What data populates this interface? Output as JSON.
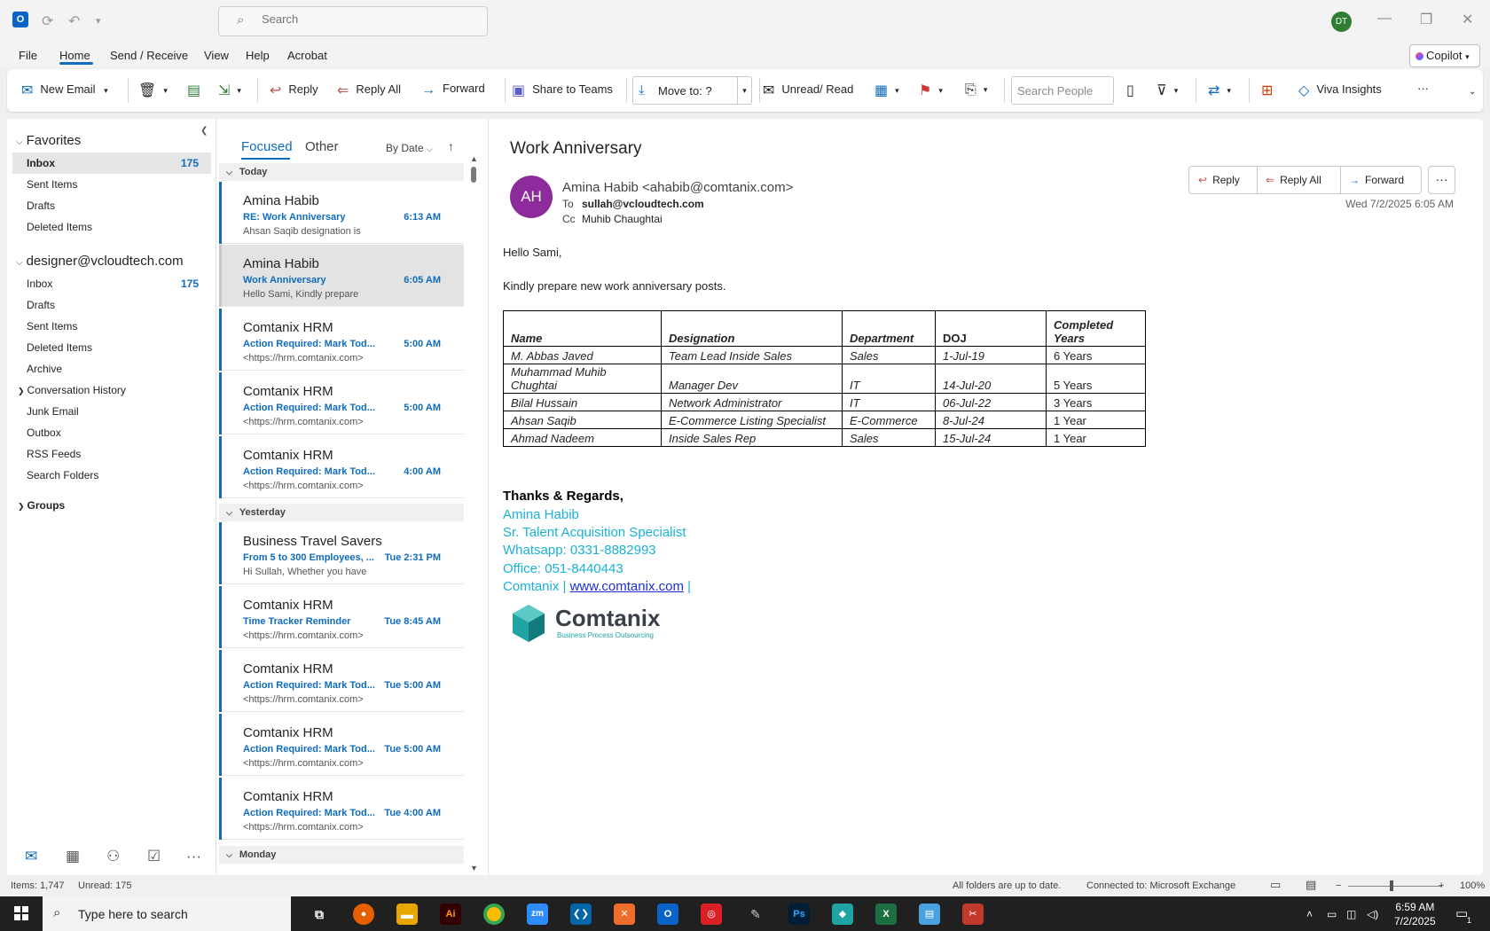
{
  "titlebar": {
    "search_placeholder": "Search",
    "user_initials": "DT"
  },
  "menu": {
    "file": "File",
    "home": "Home",
    "send_receive": "Send / Receive",
    "view": "View",
    "help": "Help",
    "acrobat": "Acrobat",
    "copilot": "Copilot"
  },
  "ribbon": {
    "new_email": "New Email",
    "reply": "Reply",
    "reply_all": "Reply All",
    "forward": "Forward",
    "share_teams": "Share to Teams",
    "move_to": "Move to: ?",
    "unread_read": "Unread/ Read",
    "search_people_placeholder": "Search People",
    "viva": "Viva Insights"
  },
  "folders": {
    "favorites_label": "Favorites",
    "favorites": [
      {
        "label": "Inbox",
        "count": "175",
        "selected": true
      },
      {
        "label": "Sent Items",
        "count": ""
      },
      {
        "label": "Drafts",
        "count": ""
      },
      {
        "label": "Deleted Items",
        "count": ""
      }
    ],
    "account_label": "designer@vcloudtech.com",
    "account": [
      {
        "label": "Inbox",
        "count": "175"
      },
      {
        "label": "Drafts"
      },
      {
        "label": "Sent Items"
      },
      {
        "label": "Deleted Items"
      },
      {
        "label": "Archive"
      },
      {
        "label": "Conversation History"
      },
      {
        "label": "Junk Email"
      },
      {
        "label": "Outbox"
      },
      {
        "label": "RSS Feeds"
      },
      {
        "label": "Search Folders"
      }
    ],
    "groups_label": "Groups"
  },
  "msglist": {
    "tab_focused": "Focused",
    "tab_other": "Other",
    "sort": "By Date",
    "group_today": "Today",
    "group_yesterday": "Yesterday",
    "group_monday": "Monday",
    "messages": [
      {
        "sender": "Amina Habib",
        "subject": "RE: Work Anniversary",
        "time": "6:13 AM",
        "preview": "Ahsan Saqib designation is"
      },
      {
        "sender": "Amina Habib",
        "subject": "Work Anniversary",
        "time": "6:05 AM",
        "preview": "Hello Sami,  Kindly prepare"
      },
      {
        "sender": "Comtanix HRM",
        "subject": "Action Required: Mark Tod...",
        "time": "5:00 AM",
        "preview": "<https://hrm.comtanix.com>"
      },
      {
        "sender": "Comtanix HRM",
        "subject": "Action Required: Mark Tod...",
        "time": "5:00 AM",
        "preview": "<https://hrm.comtanix.com>"
      },
      {
        "sender": "Comtanix HRM",
        "subject": "Action Required: Mark Tod...",
        "time": "4:00 AM",
        "preview": "<https://hrm.comtanix.com>"
      },
      {
        "sender": "Business Travel Savers",
        "subject": "From 5 to 300 Employees, ...",
        "time": "Tue 2:31 PM",
        "preview": "Hi Sullah,  Whether you have"
      },
      {
        "sender": "Comtanix HRM",
        "subject": "Time Tracker Reminder",
        "time": "Tue 8:45 AM",
        "preview": "<https://hrm.comtanix.com>"
      },
      {
        "sender": "Comtanix HRM",
        "subject": "Action Required: Mark Tod...",
        "time": "Tue 5:00 AM",
        "preview": "<https://hrm.comtanix.com>"
      },
      {
        "sender": "Comtanix HRM",
        "subject": "Action Required: Mark Tod...",
        "time": "Tue 5:00 AM",
        "preview": "<https://hrm.comtanix.com>"
      },
      {
        "sender": "Comtanix HRM",
        "subject": "Action Required: Mark Tod...",
        "time": "Tue 4:00 AM",
        "preview": "<https://hrm.comtanix.com>"
      }
    ]
  },
  "mail": {
    "subject": "Work Anniversary",
    "avatar": "AH",
    "from": "Amina Habib <ahabib@comtanix.com>",
    "to_label": "To",
    "to": "sullah@vcloudtech.com",
    "cc_label": "Cc",
    "cc": "Muhib Chaughtai",
    "date": "Wed 7/2/2025 6:05 AM",
    "reply": "Reply",
    "reply_all": "Reply All",
    "forward": "Forward",
    "greeting": "Hello Sami,",
    "line1": "Kindly prepare new work anniversary posts.",
    "table": {
      "headers": [
        "Name",
        "Designation",
        "Department",
        "DOJ",
        "Completed Years"
      ],
      "rows": [
        [
          "M. Abbas Javed",
          "Team Lead Inside Sales",
          "Sales",
          "1-Jul-19",
          "6 Years"
        ],
        [
          "Muhammad Muhib Chughtai",
          "Manager Dev",
          "IT",
          "14-Jul-20",
          "5 Years"
        ],
        [
          "Bilal Hussain",
          "Network Administrator",
          "IT",
          "06-Jul-22",
          "3 Years"
        ],
        [
          "Ahsan Saqib",
          "E-Commerce Listing Specialist",
          "E-Commerce",
          "8-Jul-24",
          "1 Year"
        ],
        [
          "Ahmad Nadeem",
          "Inside Sales Rep",
          "Sales",
          "15-Jul-24",
          "1 Year"
        ]
      ]
    },
    "sig_thanks": "Thanks & Regards,",
    "sig_name": "Amina Habib",
    "sig_title": "Sr. Talent Acquisition Specialist",
    "sig_whatsapp": "Whatsapp: 0331-8882993",
    "sig_office": "Office: 051-8440443",
    "sig_company": "Comtanix | ",
    "sig_link": "www.comtanix.com",
    "sig_pipe": " |",
    "logo_name": "Comtanix",
    "logo_tag": "Business Process Outsourcing"
  },
  "status": {
    "items": "Items: 1,747",
    "unread": "Unread: 175",
    "sync": "All folders are up to date.",
    "connected": "Connected to: Microsoft Exchange",
    "zoom": "100%"
  },
  "taskbar": {
    "search": "Type here to search",
    "time": "6:59 AM",
    "date": "7/2/2025",
    "notif": "1"
  },
  "colors": {
    "accent": "#0f6cbd",
    "signature": "#1ab2d6",
    "avatar": "#8e2b9c"
  }
}
